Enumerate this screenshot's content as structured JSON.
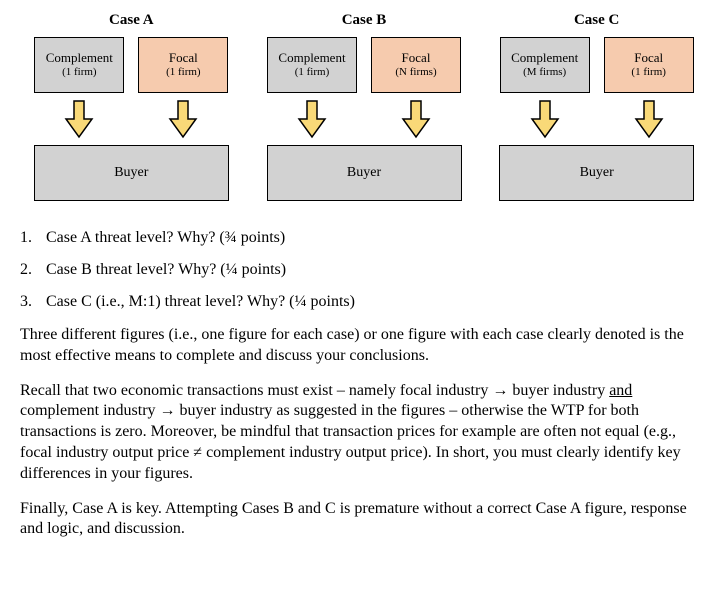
{
  "cases": [
    {
      "title": "Case A",
      "complement_label": "Complement",
      "complement_sub": "(1 firm)",
      "focal_label": "Focal",
      "focal_sub": "(1 firm)",
      "buyer_label": "Buyer"
    },
    {
      "title": "Case B",
      "complement_label": "Complement",
      "complement_sub": "(1 firm)",
      "focal_label": "Focal",
      "focal_sub": "(N firms)",
      "buyer_label": "Buyer"
    },
    {
      "title": "Case C",
      "complement_label": "Complement",
      "complement_sub": "(M firms)",
      "focal_label": "Focal",
      "focal_sub": "(1 firm)",
      "buyer_label": "Buyer"
    }
  ],
  "questions": {
    "q1_num": "1.",
    "q1_text": "Case A threat level? Why? (¾ points)",
    "q2_num": "2.",
    "q2_text": "Case B threat level? Why? (¼ points)",
    "q3_num": "3.",
    "q3_text": "Case C (i.e., M:1) threat level? Why? (¼ points)"
  },
  "paragraphs": {
    "p1": "Three different figures (i.e., one figure for each case) or one figure with each case clearly denoted is the most effective means to complete and discuss your conclusions.",
    "p2a": "Recall that two economic transactions must exist – namely focal industry → buyer industry ",
    "p2_and": "and",
    "p2b": " complement industry → buyer industry as suggested in the figures – otherwise the WTP for both transactions is zero. Moreover, be mindful that transaction prices for example are often not equal (e.g., focal industry output price ≠ complement industry output price). In short, you must clearly identify key differences in your figures.",
    "p3": "Finally, Case A is key. Attempting Cases B and C is premature without a correct Case A figure, response and logic, and discussion."
  },
  "colors": {
    "complement_bg": "#d2d2d2",
    "focal_bg": "#f6cbae",
    "arrow_fill": "#f9d978",
    "arrow_stroke": "#000000"
  }
}
